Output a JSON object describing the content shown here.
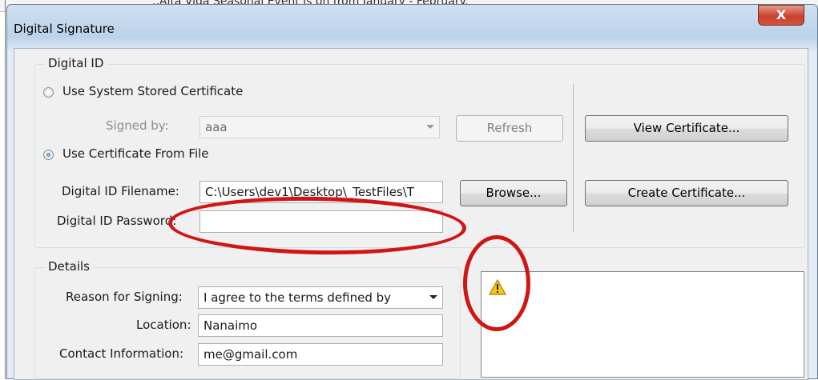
{
  "background": {
    "text": "..Alta Vida Seasonal Event is on from January - February."
  },
  "window": {
    "title": "Digital Signature",
    "close_label": "X"
  },
  "digital_id": {
    "legend": "Digital ID",
    "radio_system_label": "Use System Stored Certificate",
    "signed_by_label": "Signed by:",
    "signed_by_value": "aaa",
    "refresh_label": "Refresh",
    "view_certificate_label": "View Certificate...",
    "radio_file_label": "Use Certificate From File",
    "filename_label": "Digital ID Filename:",
    "filename_value": "C:\\Users\\dev1\\Desktop\\_TestFiles\\T",
    "browse_label": "Browse...",
    "create_certificate_label": "Create Certificate...",
    "password_label": "Digital ID Password:",
    "password_value": ""
  },
  "details": {
    "legend": "Details",
    "reason_label": "Reason for Signing:",
    "reason_value": "I agree to the terms defined by",
    "location_label": "Location:",
    "location_value": "Nanaimo",
    "contact_label": "Contact Information:",
    "contact_value": "me@gmail.com"
  },
  "colors": {
    "annotation_red": "#d11414",
    "title_gradient": "#bcd2ea",
    "warning_yellow": "#f5c518"
  },
  "icons": {
    "warning": "warning-icon",
    "close": "close-icon"
  }
}
